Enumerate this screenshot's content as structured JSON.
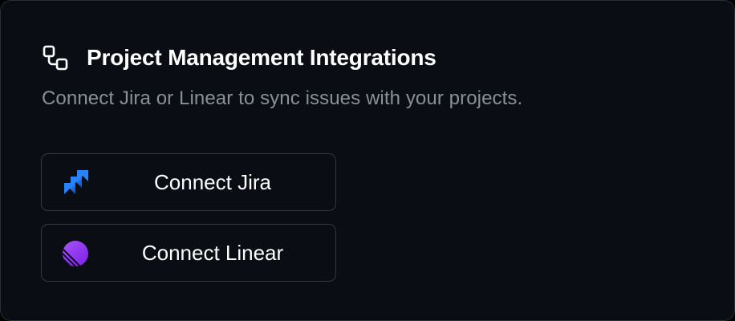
{
  "card": {
    "title": "Project Management Integrations",
    "subtitle": "Connect Jira or Linear to sync issues with your projects.",
    "header_icon": "workflow-icon"
  },
  "integrations": [
    {
      "id": "jira",
      "label": "Connect Jira",
      "icon": "jira-icon",
      "brand_color": "#2684ff"
    },
    {
      "id": "linear",
      "label": "Connect Linear",
      "icon": "linear-icon",
      "brand_color": "#8b3cf7"
    }
  ],
  "colors": {
    "background": "#0a0d13",
    "border": "#2a2f3a",
    "title": "#ffffff",
    "subtitle": "#8a8f99"
  }
}
